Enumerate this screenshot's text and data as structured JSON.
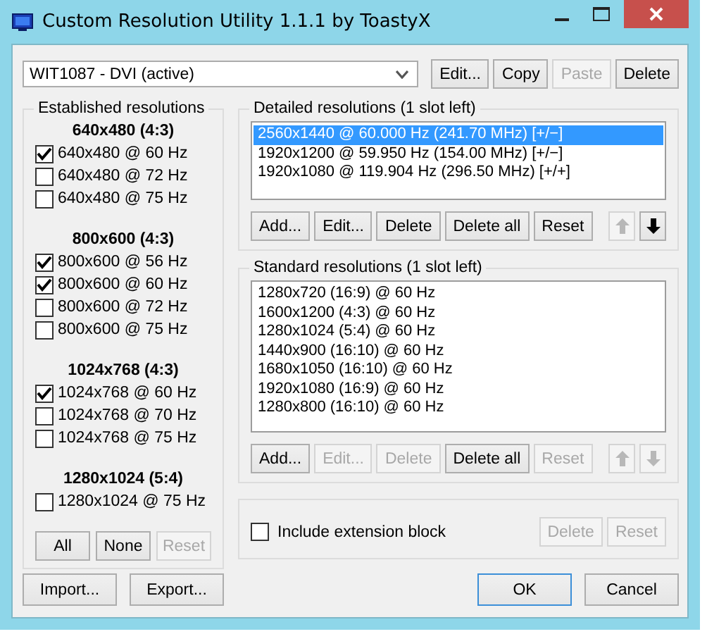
{
  "window": {
    "title": "Custom Resolution Utility 1.1.1 by ToastyX"
  },
  "device_select": {
    "value": "WIT1087 - DVI (active)"
  },
  "device_buttons": [
    {
      "label": "Edit...",
      "disabled": false
    },
    {
      "label": "Copy",
      "disabled": false
    },
    {
      "label": "Paste",
      "disabled": true
    },
    {
      "label": "Delete",
      "disabled": false
    }
  ],
  "established": {
    "title": "Established resolutions",
    "groups": [
      {
        "heading": "640x480 (4:3)",
        "items": [
          {
            "label": "640x480 @ 60 Hz",
            "checked": true
          },
          {
            "label": "640x480 @ 72 Hz",
            "checked": false
          },
          {
            "label": "640x480 @ 75 Hz",
            "checked": false
          }
        ]
      },
      {
        "heading": "800x600 (4:3)",
        "items": [
          {
            "label": "800x600 @ 56 Hz",
            "checked": true
          },
          {
            "label": "800x600 @ 60 Hz",
            "checked": true
          },
          {
            "label": "800x600 @ 72 Hz",
            "checked": false
          },
          {
            "label": "800x600 @ 75 Hz",
            "checked": false
          }
        ]
      },
      {
        "heading": "1024x768 (4:3)",
        "items": [
          {
            "label": "1024x768 @ 60 Hz",
            "checked": true
          },
          {
            "label": "1024x768 @ 70 Hz",
            "checked": false
          },
          {
            "label": "1024x768 @ 75 Hz",
            "checked": false
          }
        ]
      },
      {
        "heading": "1280x1024 (5:4)",
        "items": [
          {
            "label": "1280x1024 @ 75 Hz",
            "checked": false
          }
        ]
      }
    ],
    "buttons": [
      {
        "label": "All",
        "disabled": false
      },
      {
        "label": "None",
        "disabled": false
      },
      {
        "label": "Reset",
        "disabled": true
      }
    ]
  },
  "detailed": {
    "title": "Detailed resolutions (1 slot left)",
    "items": [
      {
        "label": "2560x1440 @ 60.000 Hz (241.70 MHz) [+/−]",
        "selected": true
      },
      {
        "label": "1920x1200 @ 59.950 Hz (154.00 MHz) [+/−]",
        "selected": false
      },
      {
        "label": "1920x1080 @ 119.904 Hz (296.50 MHz) [+/+]",
        "selected": false
      }
    ],
    "buttons": [
      {
        "label": "Add...",
        "disabled": false
      },
      {
        "label": "Edit...",
        "disabled": false
      },
      {
        "label": "Delete",
        "disabled": false
      },
      {
        "label": "Delete all",
        "disabled": false
      },
      {
        "label": "Reset",
        "disabled": false
      }
    ],
    "move_buttons": [
      {
        "kind": "up",
        "disabled": true
      },
      {
        "kind": "down",
        "disabled": false
      }
    ]
  },
  "standard": {
    "title": "Standard resolutions (1 slot left)",
    "items": [
      {
        "label": "1280x720 (16:9) @ 60 Hz",
        "selected": false
      },
      {
        "label": "1600x1200 (4:3) @ 60 Hz",
        "selected": false
      },
      {
        "label": "1280x1024 (5:4) @ 60 Hz",
        "selected": false
      },
      {
        "label": "1440x900 (16:10) @ 60 Hz",
        "selected": false
      },
      {
        "label": "1680x1050 (16:10) @ 60 Hz",
        "selected": false
      },
      {
        "label": "1920x1080 (16:9) @ 60 Hz",
        "selected": false
      },
      {
        "label": "1280x800 (16:10) @ 60 Hz",
        "selected": false
      }
    ],
    "buttons": [
      {
        "label": "Add...",
        "disabled": false
      },
      {
        "label": "Edit...",
        "disabled": true
      },
      {
        "label": "Delete",
        "disabled": true
      },
      {
        "label": "Delete all",
        "disabled": false
      },
      {
        "label": "Reset",
        "disabled": true
      }
    ],
    "move_buttons": [
      {
        "kind": "up",
        "disabled": true
      },
      {
        "kind": "down",
        "disabled": true
      }
    ]
  },
  "extension": {
    "label": "Include extension block",
    "checked": false,
    "buttons": [
      {
        "label": "Delete",
        "disabled": true
      },
      {
        "label": "Reset",
        "disabled": true
      }
    ]
  },
  "footer": {
    "left_buttons": [
      {
        "label": "Import...",
        "disabled": false,
        "default": false
      },
      {
        "label": "Export...",
        "disabled": false,
        "default": false
      }
    ],
    "right_buttons": [
      {
        "label": "OK",
        "disabled": false,
        "default": true
      },
      {
        "label": "Cancel",
        "disabled": false,
        "default": false
      }
    ]
  }
}
